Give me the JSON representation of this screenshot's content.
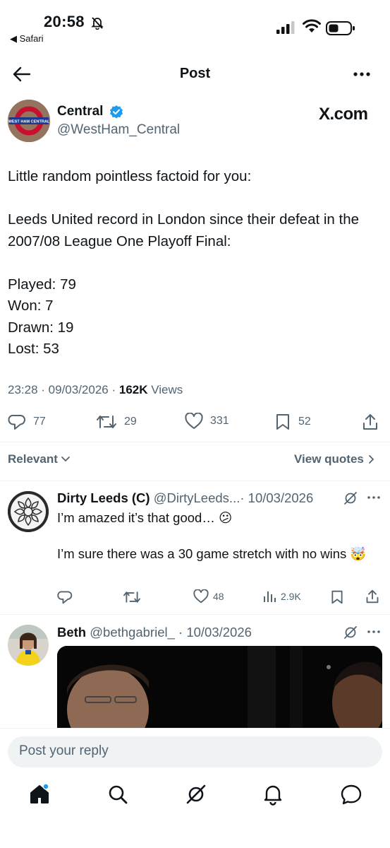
{
  "status_bar": {
    "time": "20:58",
    "back_label": "◀ Safari"
  },
  "header": {
    "title": "Post"
  },
  "author": {
    "name": "Central",
    "handle": "@WestHam_Central",
    "avatar_text": "WEST HAM CENTRAL",
    "source": "X.com"
  },
  "tweet": {
    "text": "Little random pointless factoid for you:\n\nLeeds United record in London since their defeat in the 2007/08 League One Playoff Final:\n\nPlayed: 79\nWon: 7\nDrawn: 19\nLost: 53",
    "time": "23:28",
    "date": "09/03/2026",
    "views_count": "162K",
    "views_label": "Views",
    "replies": "77",
    "reposts": "29",
    "likes": "331",
    "bookmarks": "52"
  },
  "sort": {
    "relevant_label": "Relevant",
    "view_quotes_label": "View quotes"
  },
  "replies": [
    {
      "name": "Dirty Leeds (C)",
      "handle": "@DirtyLeeds...",
      "date": "· 10/03/2026",
      "text1": "I’m amazed it’s that good… 😕",
      "text2": "I’m sure there was a 30 game stretch with no wins 🤯",
      "likes": "48",
      "views": "2.9K"
    },
    {
      "name": "Beth",
      "handle": "@bethgabriel_",
      "date": "· 10/03/2026"
    }
  ],
  "compose": {
    "placeholder": "Post your reply"
  },
  "colors": {
    "accent": "#1d9bf0",
    "muted": "#536471",
    "text": "#0f1419"
  }
}
